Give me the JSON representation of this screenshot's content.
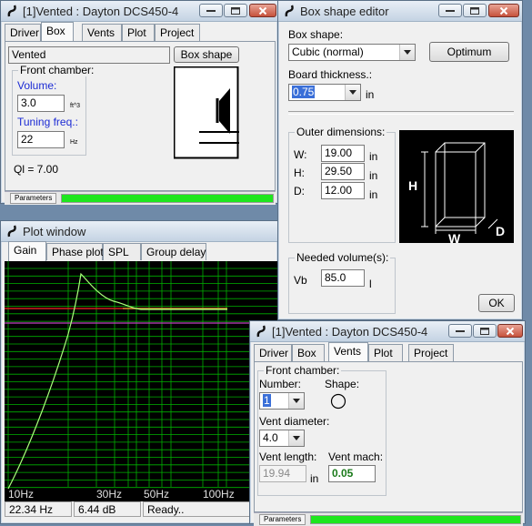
{
  "colors": {
    "plot_bg": "#000000",
    "grid": "#00b000",
    "curve": "#a8ff7a",
    "red_line": "#d02020",
    "violet_line": "#c040c0",
    "orange_line": "#d0a030",
    "progress": "#1ee61e"
  },
  "win1": {
    "title": "[1]Vented : Dayton DCS450-4",
    "tabs": [
      "Driver",
      "Box",
      "Vents",
      "Plot",
      "Project"
    ],
    "active_tab": "Box",
    "box_type": "Vented",
    "box_shape_button": "Box shape",
    "front_chamber_label": "Front chamber:",
    "volume_label": "Volume:",
    "volume_value": "3.0",
    "volume_unit": "ft^3",
    "tuning_label": "Tuning freq.:",
    "tuning_value": "22",
    "tuning_unit": "Hz",
    "ql": "Ql = 7.00",
    "params_label": "Parameters"
  },
  "plot": {
    "title": "Plot window",
    "tabs": [
      "Gain",
      "Phase plot",
      "SPL",
      "Group delay"
    ],
    "active_tab": "Gain",
    "x_ticks": [
      "10Hz",
      "30Hz",
      "50Hz",
      "100Hz"
    ],
    "status": {
      "freq": "22.34 Hz",
      "gain": "6.44 dB",
      "state": "Ready.."
    }
  },
  "shape_editor": {
    "title": "Box shape editor",
    "box_shape_label": "Box shape:",
    "box_shape_value": "Cubic (normal)",
    "optimum_button": "Optimum",
    "thickness_label": "Board thickness.:",
    "thickness_value": "0.75",
    "thickness_unit": "in",
    "outer_label": "Outer dimensions:",
    "w_label": "W:",
    "w_value": "19.00",
    "h_label": "H:",
    "h_value": "29.50",
    "d_label": "D:",
    "d_value": "12.00",
    "unit": "in",
    "diagram": {
      "h": "H",
      "w": "W",
      "d": "D"
    },
    "needed_label": "Needed volume(s):",
    "vb_label": "Vb",
    "vb_value": "85.0",
    "vb_unit": "l",
    "ok_button": "OK"
  },
  "win2": {
    "title": "[1]Vented : Dayton DCS450-4",
    "tabs": [
      "Driver",
      "Box",
      "Vents",
      "Plot",
      "Project"
    ],
    "active_tab": "Vents",
    "front_chamber_label": "Front chamber:",
    "number_label": "Number:",
    "number_value": "1",
    "shape_label": "Shape:",
    "vent_diameter_label": "Vent diameter:",
    "vent_diameter_value": "4.0",
    "vent_length_label": "Vent length:",
    "vent_length_value": "19.94",
    "vent_mach_label": "Vent mach:",
    "vent_mach_value": "0.05",
    "unit": "in",
    "params_label": "Parameters"
  }
}
